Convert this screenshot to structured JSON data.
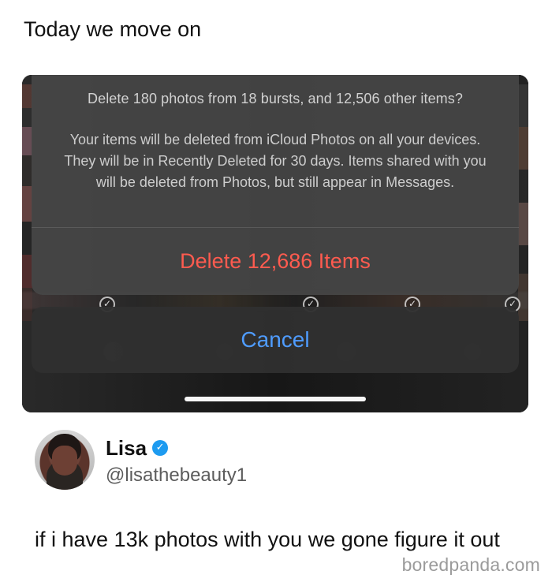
{
  "caption": {
    "text": "Today we move on"
  },
  "screenshot": {
    "alert": {
      "title": "Delete 180 photos from 18 bursts, and 12,506 other items?",
      "message": "Your items will be deleted from iCloud Photos on all your devices. They will be in Recently Deleted for 30 days. Items shared with you will be deleted from Photos, but still appear in Messages.",
      "delete_label": "Delete 12,686 Items",
      "cancel_label": "Cancel"
    },
    "icons": {
      "selection": "check-circle-icon"
    },
    "colors": {
      "destructive": "#ff5b4f",
      "cancel": "#4f9cff",
      "alert_background": "#464646"
    }
  },
  "tweet": {
    "name": "Lisa",
    "handle": "@lisathebeauty1",
    "text": "if i have 13k photos with you we gone figure it out",
    "verified_icon": "verified-badge-icon",
    "verified_color": "#1d9bf0"
  },
  "watermark": {
    "text": "boredpanda.com"
  }
}
